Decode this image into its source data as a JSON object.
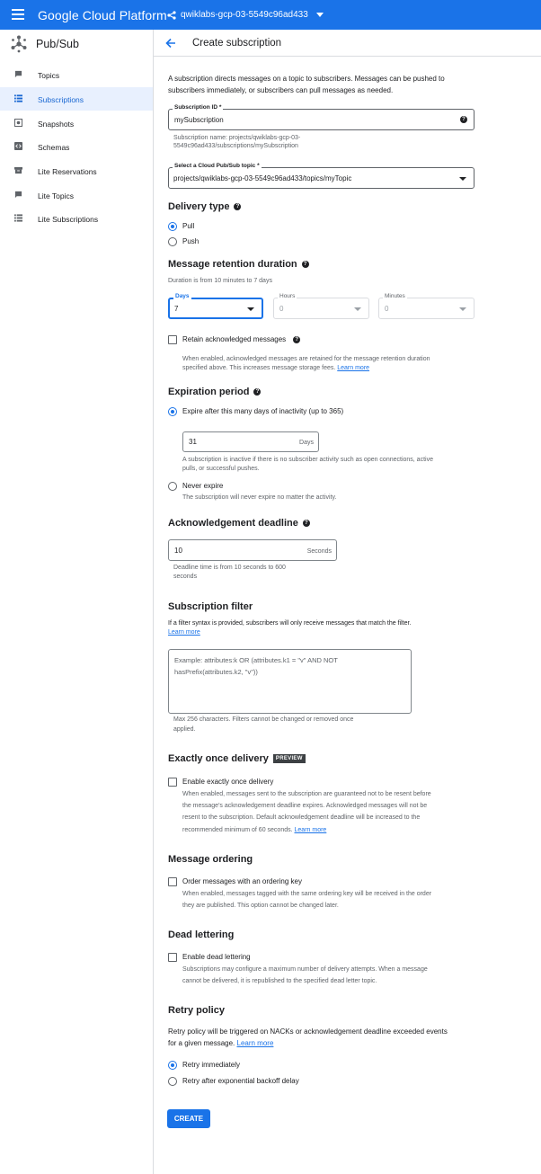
{
  "topbar": {
    "brand": "Google Cloud Platform",
    "project": "qwiklabs-gcp-03-5549c96ad433"
  },
  "sidebar": {
    "service": "Pub/Sub",
    "items": [
      {
        "label": "Topics"
      },
      {
        "label": "Subscriptions",
        "active": true
      },
      {
        "label": "Snapshots"
      },
      {
        "label": "Schemas"
      },
      {
        "label": "Lite Reservations"
      },
      {
        "label": "Lite Topics"
      },
      {
        "label": "Lite Subscriptions"
      }
    ]
  },
  "header": {
    "title": "Create subscription"
  },
  "intro": {
    "line1": "A subscription directs messages on a topic to subscribers. Messages can be pushed to",
    "line2": "subscribers immediately, or subscribers can pull messages as needed."
  },
  "subscription_id": {
    "label": "Subscription ID *",
    "value": "mySubscription",
    "hint1": "Subscription name: projects/qwiklabs-gcp-03-",
    "hint2": "5549c96ad433/subscriptions/mySubscription"
  },
  "topic": {
    "label": "Select a Cloud Pub/Sub topic *",
    "value": "projects/qwiklabs-gcp-03-5549c96ad433/topics/myTopic"
  },
  "delivery": {
    "title": "Delivery type",
    "pull": "Pull",
    "push": "Push",
    "selected": "Pull"
  },
  "retention": {
    "title": "Message retention duration",
    "hint": "Duration is from 10 minutes to 7 days",
    "days_label": "Days",
    "days_value": "7",
    "hours_label": "Hours",
    "hours_value": "0",
    "minutes_label": "Minutes",
    "minutes_value": "0",
    "retain_label": "Retain acknowledged messages",
    "retain_desc1": "When enabled, acknowledged messages are retained for the message retention duration",
    "retain_desc2": "specified above. This increases message storage fees.",
    "learn_more": "Learn more"
  },
  "expiration": {
    "title": "Expiration period",
    "expire_label": "Expire after this many days of inactivity (up to 365)",
    "days_value": "31",
    "days_suffix": "Days",
    "desc1": "A subscription is inactive if there is no subscriber activity such as open connections, active",
    "desc2": "pulls, or successful pushes.",
    "never_label": "Never expire",
    "never_desc": "The subscription will never expire no matter the activity."
  },
  "ack": {
    "title": "Acknowledgement deadline",
    "value": "10",
    "suffix": "Seconds",
    "hint1": "Deadline time is from 10 seconds to 600",
    "hint2": "seconds"
  },
  "filter": {
    "title": "Subscription filter",
    "desc": "If a filter syntax is provided, subscribers will only receive messages that match the filter.",
    "learn_more": "Learn more",
    "placeholder1": "Example: attributes:k OR (attributes.k1 = \"v\" AND NOT",
    "placeholder2": "hasPrefix(attributes.k2, \"v\"))",
    "hint1": "Max 256 characters. Filters cannot be changed or removed once",
    "hint2": "applied."
  },
  "exactly_once": {
    "title": "Exactly once delivery",
    "badge": "PREVIEW",
    "label": "Enable exactly once delivery",
    "desc1": "When enabled, messages sent to the subscription are guaranteed not to be resent before",
    "desc2": "the message's acknowledgement deadline expires. Acknowledged messages will not be",
    "desc3": "resent to the subscription. Default acknowledgement deadline will be increased to the",
    "desc4": "recommended minimum of 60 seconds.",
    "learn_more": "Learn more"
  },
  "ordering": {
    "title": "Message ordering",
    "label": "Order messages with an ordering key",
    "desc1": "When enabled, messages tagged with the same ordering key will be received in the order",
    "desc2": "they are published. This option cannot be changed later."
  },
  "dead_letter": {
    "title": "Dead lettering",
    "label": "Enable dead lettering",
    "desc1": "Subscriptions may configure a maximum number of delivery attempts. When a message",
    "desc2": "cannot be delivered, it is republished to the specified dead letter topic."
  },
  "retry": {
    "title": "Retry policy",
    "desc1": "Retry policy will be triggered on NACKs or acknowledgement deadline exceeded events",
    "desc2": "for a given message.",
    "learn_more": "Learn more",
    "immediate": "Retry immediately",
    "backoff": "Retry after exponential backoff delay",
    "selected": "Retry immediately"
  },
  "create_label": "CREATE",
  "colors": {
    "accent": "#1a73e8",
    "active_bg": "#e8f0fe",
    "badge": "#3c4043"
  }
}
